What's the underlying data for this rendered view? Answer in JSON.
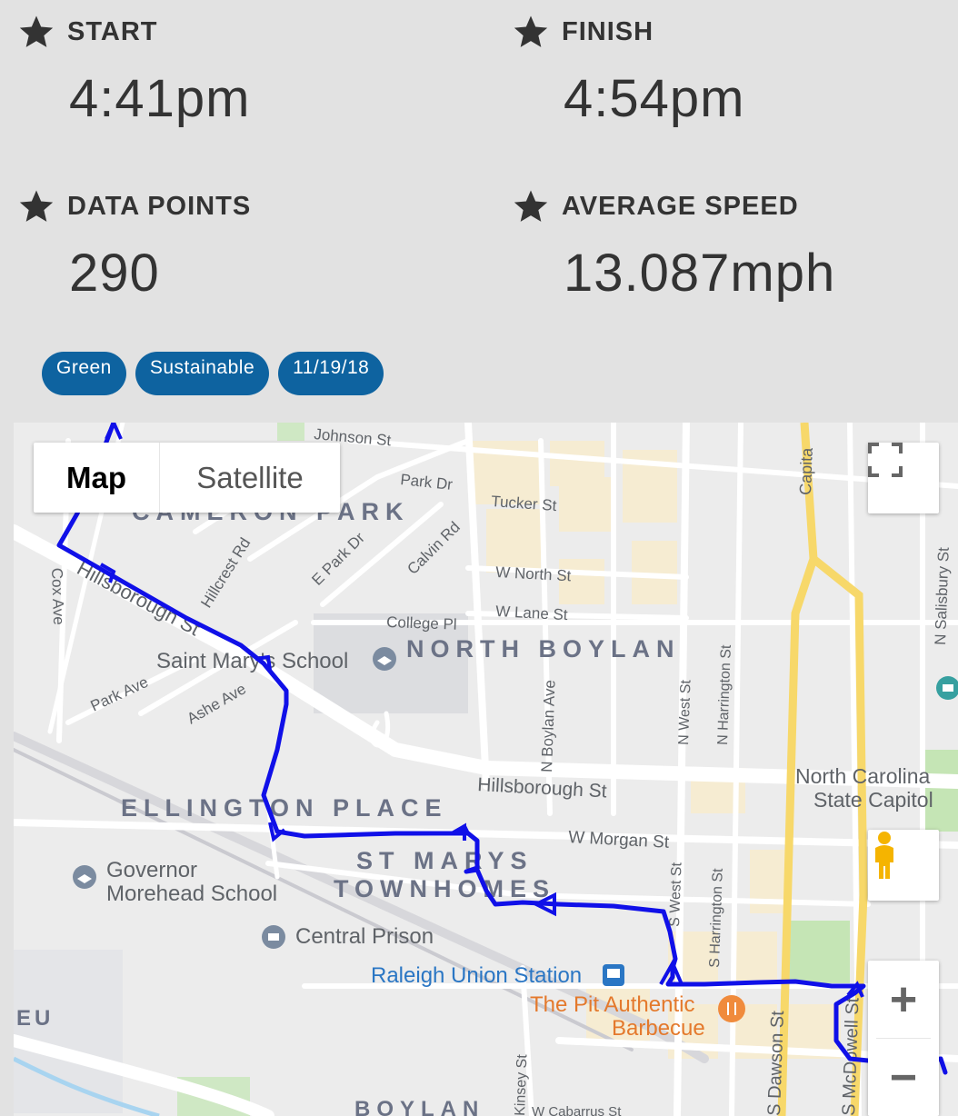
{
  "stats": {
    "start": {
      "label": "START",
      "value": "4:41pm"
    },
    "finish": {
      "label": "FINISH",
      "value": "4:54pm"
    },
    "data_points": {
      "label": "DATA POINTS",
      "value": "290"
    },
    "average_speed": {
      "label": "AVERAGE SPEED",
      "value": "13.087mph"
    }
  },
  "tags": [
    "Green",
    "Sustainable",
    "11/19/18"
  ],
  "map": {
    "type_map": "Map",
    "type_satellite": "Satellite",
    "zoom_in": "+",
    "zoom_out": "−",
    "route_color": "#1010e8",
    "labels": {
      "johnson_st": "Johnson St",
      "park_dr": "Park Dr",
      "tucker_st": "Tucker St",
      "capital": "Capita",
      "cameron_park": "CAMERON PARK",
      "hillcrest_rd": "Hillcrest Rd",
      "e_park_dr": "E Park Dr",
      "calvin_rd": "Calvin Rd",
      "w_north_st": "W North St",
      "w_lane_st": "W Lane St",
      "n_salisbury_st": "N Salisbury St",
      "cox_ave": "Cox Ave",
      "hillsborough_st_1": "Hillsborough St",
      "college_pl": "College Pl",
      "saint_marys_school": "Saint Mary's School",
      "north_boylan": "NORTH BOYLAN",
      "park_ave": "Park Ave",
      "ashe_ave": "Ashe Ave",
      "n_boylan_ave": "N Boylan Ave",
      "n_west_st": "N West St",
      "n_harrington_st": "N Harrington St",
      "hillsborough_st_2": "Hillsborough St",
      "nc_state_capitol_1": "North Carolina",
      "nc_state_capitol_2": "State Capitol",
      "ellington_place": "ELLINGTON PLACE",
      "w_morgan_st": "W Morgan St",
      "st_marys_1": "ST MARYS",
      "st_marys_2": "TOWNHOMES",
      "governor_1": "Governor",
      "governor_2": "Morehead School",
      "s_west_st": "S West St",
      "s_harrington_st": "S Harrington St",
      "central_prison": "Central Prison",
      "union_station": "Raleigh Union Station",
      "pit_1": "The Pit Authentic",
      "pit_2": "Barbecue",
      "s_dawson_st": "S Dawson St",
      "s_mcdowell_st": "S McDowell St",
      "eu": "EU",
      "kinsey_st": "Kinsey St",
      "boylan": "BOYLAN",
      "w_cabarrus": "W Cabarrus St"
    }
  }
}
